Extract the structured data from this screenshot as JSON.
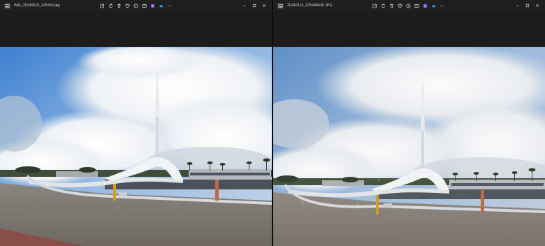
{
  "left_window": {
    "filename": "IMG_20240616_105450.jpg",
    "toolbar_icons": [
      "edit-icon",
      "rotate-icon",
      "delete-icon",
      "favorite-icon",
      "info-icon",
      "compare-icon",
      "copilot-icon",
      "onedrive-icon",
      "more-icon"
    ]
  },
  "right_window": {
    "filename": "20240616_105448635.JPG",
    "toolbar_icons": [
      "edit-icon",
      "rotate-icon",
      "delete-icon",
      "favorite-icon",
      "info-icon",
      "compare-icon",
      "copilot-icon",
      "onedrive-icon",
      "more-icon"
    ]
  },
  "window_controls": [
    "minimize",
    "maximize",
    "close"
  ],
  "colors": {
    "chrome": "#1c1c1c",
    "titlebar": "#1f1f1f",
    "copilot_accent": "#8a5cf6",
    "onedrive_accent": "#3b8fe8"
  }
}
